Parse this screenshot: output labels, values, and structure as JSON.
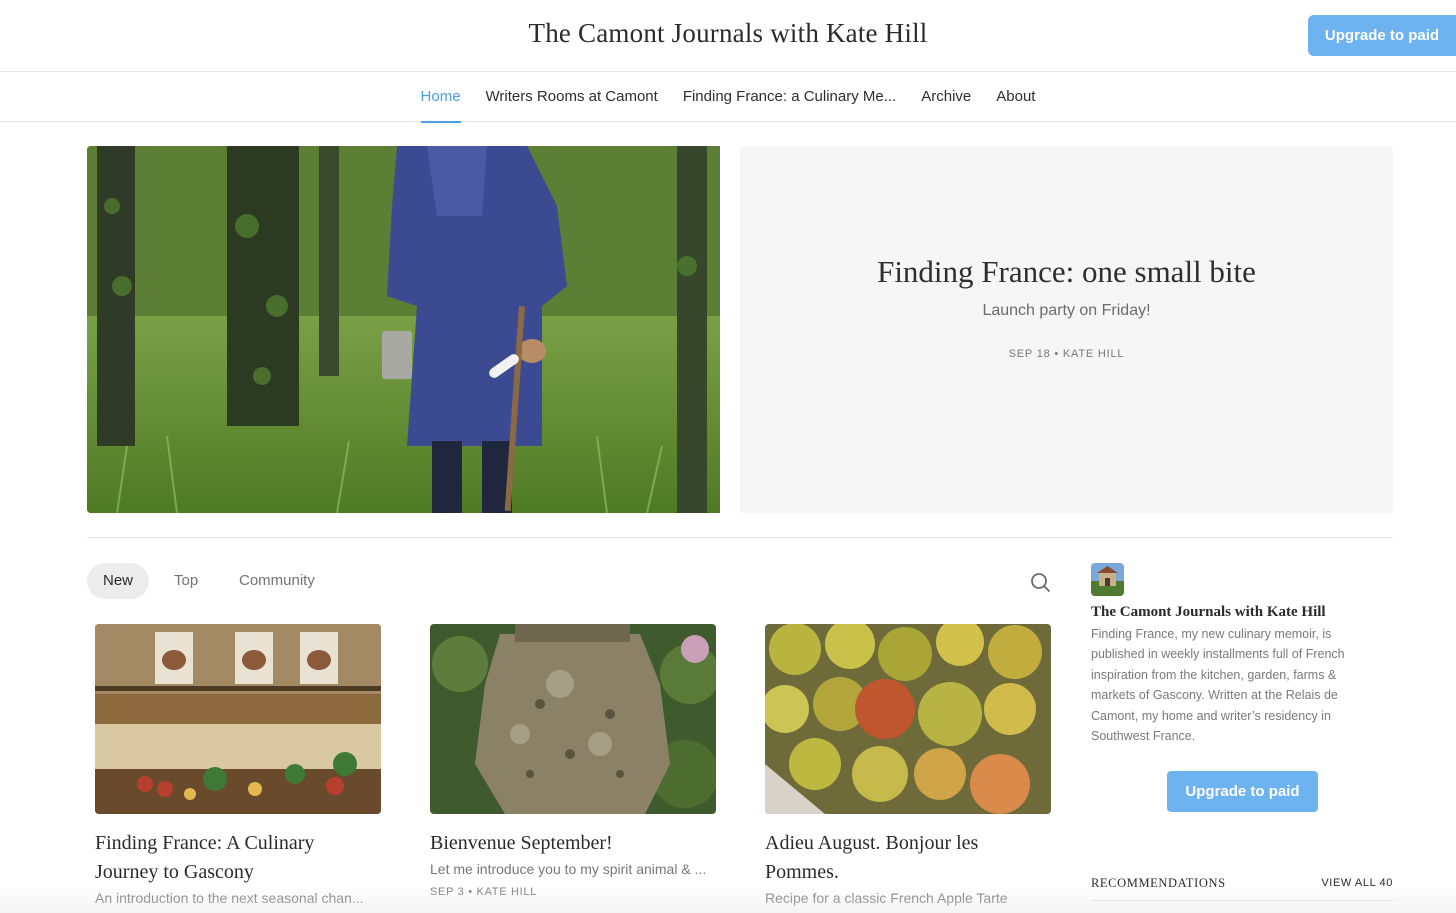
{
  "header": {
    "site_title": "The Camont Journals with Kate Hill",
    "upgrade_label": "Upgrade to paid"
  },
  "nav": {
    "items": [
      {
        "label": "Home",
        "active": true
      },
      {
        "label": "Writers Rooms at Camont",
        "active": false
      },
      {
        "label": "Finding France: a Culinary Me...",
        "active": false
      },
      {
        "label": "Archive",
        "active": false
      },
      {
        "label": "About",
        "active": false
      }
    ]
  },
  "hero": {
    "title": "Finding France: one small bite",
    "subtitle": "Launch party on Friday!",
    "meta": "SEP 18 • KATE HILL"
  },
  "tabs": [
    "New",
    "Top",
    "Community"
  ],
  "posts": [
    {
      "title": "Finding France: A Culinary Journey to Gascony",
      "subtitle": "An introduction to the next seasonal chan...",
      "meta": ""
    },
    {
      "title": "Bienvenue September!",
      "subtitle": "Let me introduce you to my spirit animal & ...",
      "meta": "SEP 3 • KATE HILL"
    },
    {
      "title": "Adieu August. Bonjour les Pommes.",
      "subtitle": "Recipe for a classic French Apple Tarte",
      "meta": ""
    }
  ],
  "sidebar": {
    "name": "The Camont Journals with Kate Hill",
    "description": "Finding France, my new culinary memoir, is published in weekly installments full of French inspiration from the kitchen, garden, farms & markets of Gascony. Written at the Relais de Camont, my home and writer’s residency in Southwest France.",
    "upgrade_label": "Upgrade to paid",
    "recommendations_label": "RECOMMENDATIONS",
    "view_all_label": "VIEW ALL 40"
  },
  "colors": {
    "accent": "#4a9fe8",
    "button": "#6cb3f0",
    "hero_bg": "#f6f6f6"
  },
  "icons": {
    "search": "search-icon"
  }
}
